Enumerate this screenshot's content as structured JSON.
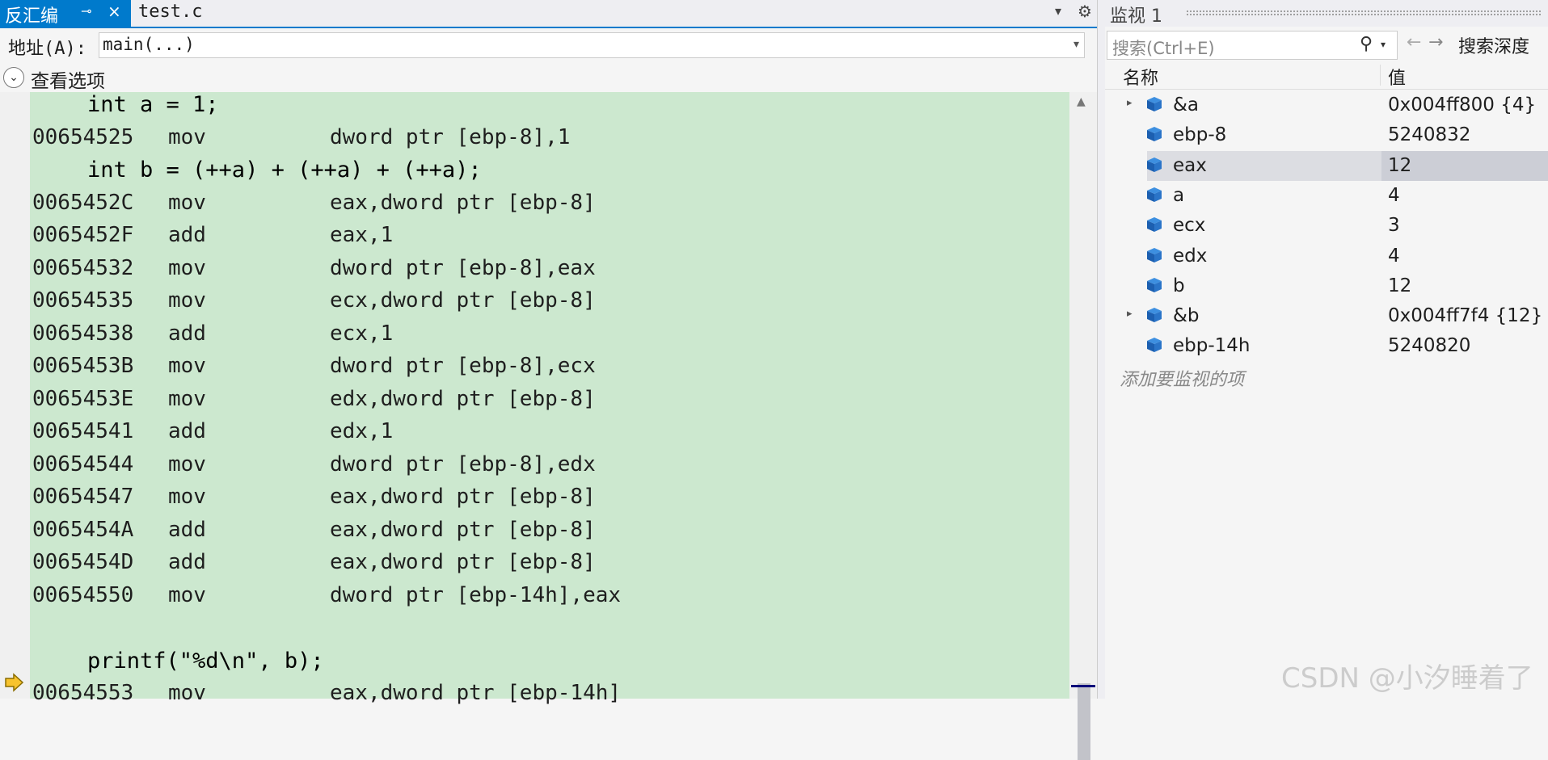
{
  "disasm": {
    "tab_title": "反汇编",
    "pin_icon": "pin-icon",
    "close_icon": "×",
    "file_tab": "test.c",
    "address_label": "地址(A):",
    "address_value": "main(...)",
    "view_options": "查看选项",
    "lines": [
      {
        "kind": "src",
        "text": "int a = 1;"
      },
      {
        "kind": "asm",
        "addr": "00654525",
        "op": "mov",
        "arg": "dword ptr [ebp-8],1"
      },
      {
        "kind": "src",
        "text": "int b = (++a) + (++a) + (++a);"
      },
      {
        "kind": "asm",
        "addr": "0065452C",
        "op": "mov",
        "arg": "eax,dword ptr [ebp-8]"
      },
      {
        "kind": "asm",
        "addr": "0065452F",
        "op": "add",
        "arg": "eax,1"
      },
      {
        "kind": "asm",
        "addr": "00654532",
        "op": "mov",
        "arg": "dword ptr [ebp-8],eax"
      },
      {
        "kind": "asm",
        "addr": "00654535",
        "op": "mov",
        "arg": "ecx,dword ptr [ebp-8]"
      },
      {
        "kind": "asm",
        "addr": "00654538",
        "op": "add",
        "arg": "ecx,1"
      },
      {
        "kind": "asm",
        "addr": "0065453B",
        "op": "mov",
        "arg": "dword ptr [ebp-8],ecx"
      },
      {
        "kind": "asm",
        "addr": "0065453E",
        "op": "mov",
        "arg": "edx,dword ptr [ebp-8]"
      },
      {
        "kind": "asm",
        "addr": "00654541",
        "op": "add",
        "arg": "edx,1"
      },
      {
        "kind": "asm",
        "addr": "00654544",
        "op": "mov",
        "arg": "dword ptr [ebp-8],edx"
      },
      {
        "kind": "asm",
        "addr": "00654547",
        "op": "mov",
        "arg": "eax,dword ptr [ebp-8]"
      },
      {
        "kind": "asm",
        "addr": "0065454A",
        "op": "add",
        "arg": "eax,dword ptr [ebp-8]"
      },
      {
        "kind": "asm",
        "addr": "0065454D",
        "op": "add",
        "arg": "eax,dword ptr [ebp-8]"
      },
      {
        "kind": "asm",
        "addr": "00654550",
        "op": "mov",
        "arg": "dword ptr [ebp-14h],eax"
      },
      {
        "kind": "blank",
        "text": ""
      },
      {
        "kind": "src",
        "text": "printf(\"%d\\n\", b);"
      },
      {
        "kind": "asm",
        "addr": "00654553",
        "op": "mov",
        "arg": "eax,dword ptr [ebp-14h]",
        "current": true
      }
    ]
  },
  "watch": {
    "title": "监视 1",
    "search_placeholder": "搜索(Ctrl+E)",
    "search_depth": "搜索深度",
    "col_name": "名称",
    "col_value": "值",
    "rows": [
      {
        "name": "&a",
        "value": "0x004ff800 {4}",
        "expandable": true
      },
      {
        "name": "ebp-8",
        "value": "5240832"
      },
      {
        "name": "eax",
        "value": "12",
        "selected": true
      },
      {
        "name": "a",
        "value": "4"
      },
      {
        "name": "ecx",
        "value": "3"
      },
      {
        "name": "edx",
        "value": "4"
      },
      {
        "name": "b",
        "value": "12"
      },
      {
        "name": "&b",
        "value": "0x004ff7f4 {12}",
        "expandable": true
      },
      {
        "name": "ebp-14h",
        "value": "5240820"
      }
    ],
    "add_item": "添加要监视的项"
  },
  "watermark": "CSDN @小汐睡着了",
  "colors": {
    "accent": "#007acc",
    "code_bg": "#cce8cf",
    "arrow": "#f7c32e"
  }
}
